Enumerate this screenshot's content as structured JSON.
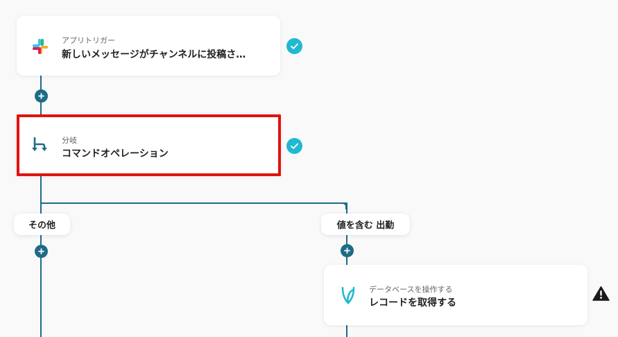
{
  "flow": {
    "trigger": {
      "caption": "アプリトリガー",
      "title": "新しいメッセージがチャンネルに投稿さ…",
      "icon": "slack-icon",
      "status": "completed"
    },
    "branch": {
      "caption": "分岐",
      "title": "コマンドオペレーション",
      "icon": "branch-icon",
      "status": "completed"
    },
    "branch_labels": {
      "left": "その他",
      "right": "値を含む 出勤"
    },
    "database_step": {
      "caption": "データベースを操作する",
      "title": "レコードを取得する",
      "icon": "yoom-database-icon",
      "status": "warning"
    }
  },
  "colors": {
    "connector": "#1d6b86",
    "check": "#22b8cf",
    "highlight": "#e0120d"
  }
}
